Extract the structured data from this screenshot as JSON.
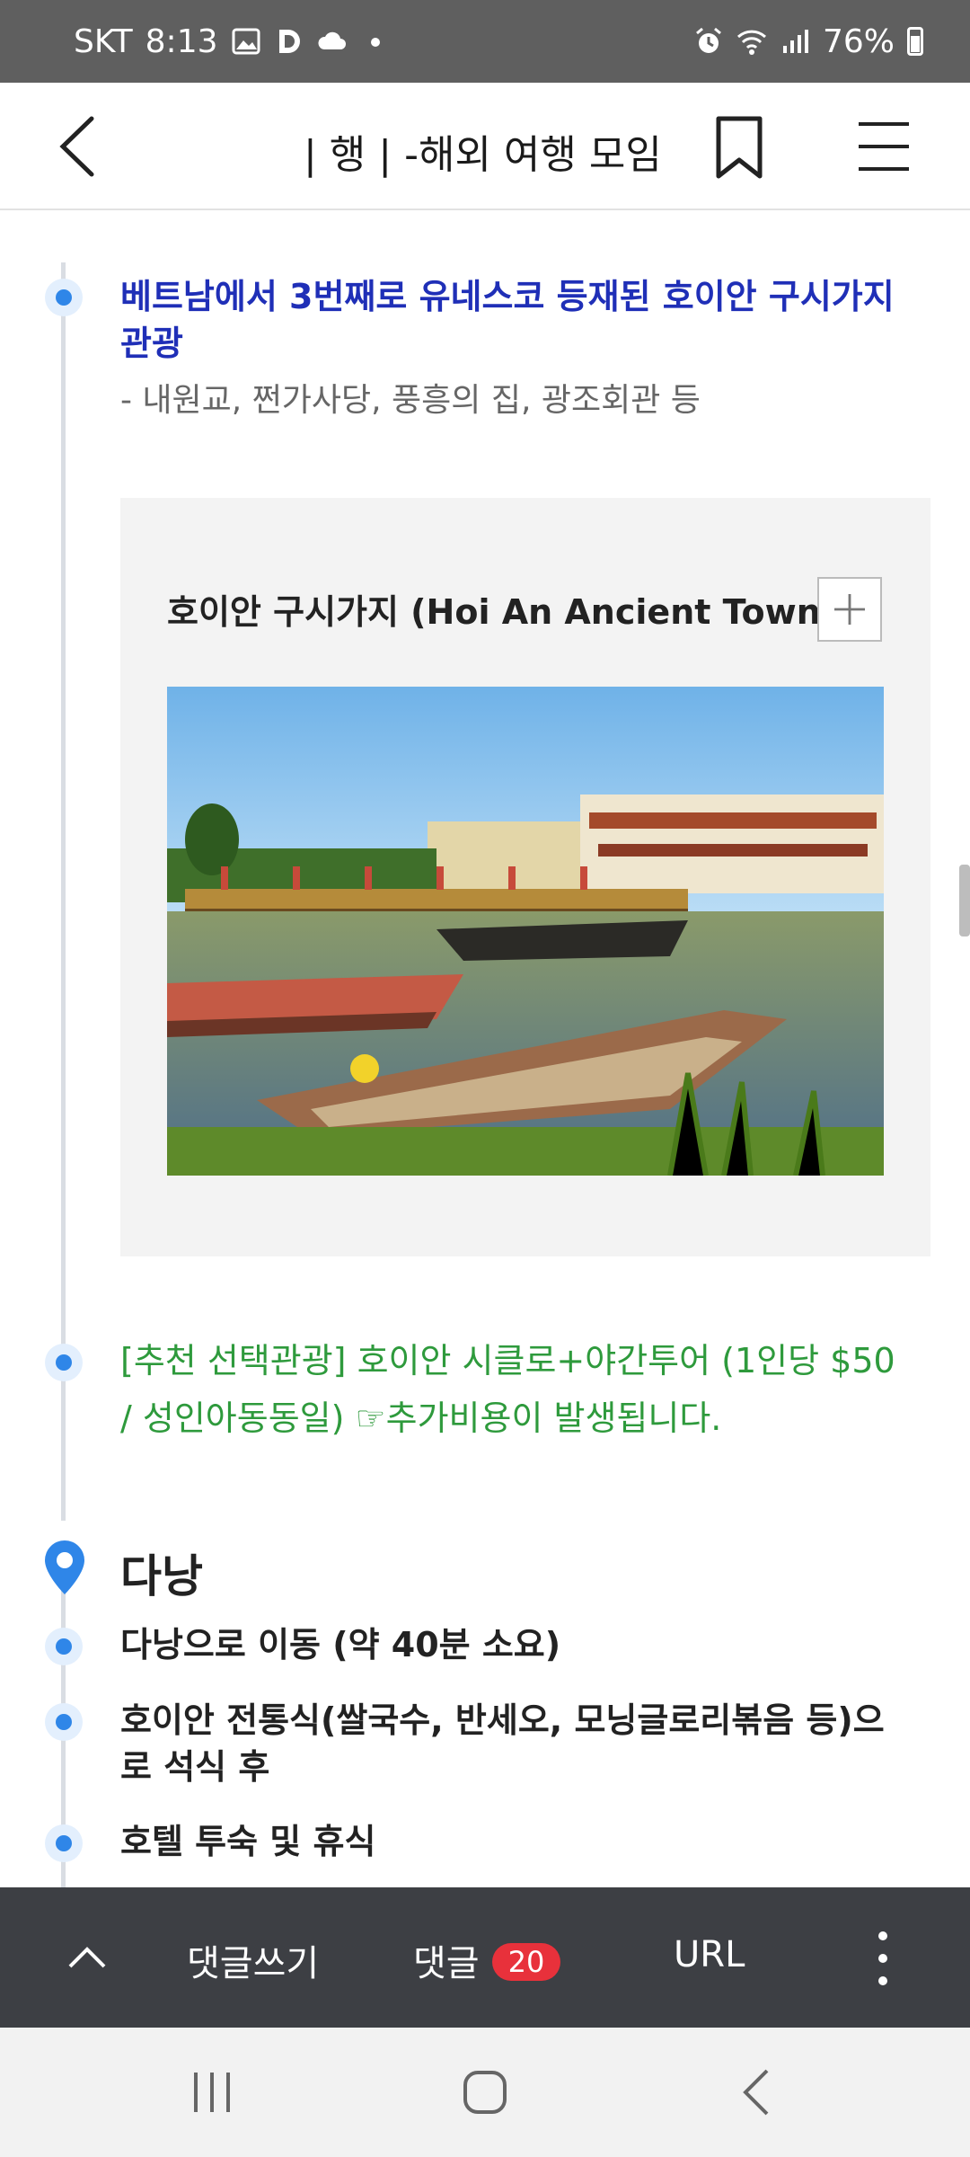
{
  "status_bar": {
    "carrier": "SKT",
    "time": "8:13",
    "notif_icons": [
      "image-icon",
      "d-app-icon",
      "cloud-icon",
      "dot-icon"
    ],
    "system_icons": [
      "alarm-icon",
      "wifi-icon",
      "signal-icon"
    ],
    "battery": "76%"
  },
  "app_bar": {
    "title": "| 행 | -해외 여행 모임"
  },
  "timeline": {
    "item1_title": "베트남에서 3번째로 유네스코 등재된 호이안 구시가지 관광",
    "item1_sub": "- 내원교, 쩐가사당, 풍흥의 집, 광조회관 등",
    "card_title": "호이안 구시가지 (Hoi An Ancient Town)",
    "item2_text": "[추천 선택관광] 호이안 시클로+야간투어 (1인당 $50 / 성인아동동일) ☞추가비용이 발생됩니다.",
    "city": "다낭",
    "city_items": [
      "다낭으로 이동 (약 40분 소요)",
      "호이안 전통식(쌀국수, 반세오, 모닝글로리볶음 등)으로 석식 후",
      "호텔 투숙 및 휴식"
    ]
  },
  "bottom_bar": {
    "write_comment": "댓글쓰기",
    "comments_label": "댓글",
    "comments_count": "20",
    "url_label": "URL"
  },
  "colors": {
    "accent_blue": "#1f2fb7",
    "green": "#2e9a3c",
    "badge_red": "#e8313b",
    "dot_blue": "#2f86e8"
  }
}
